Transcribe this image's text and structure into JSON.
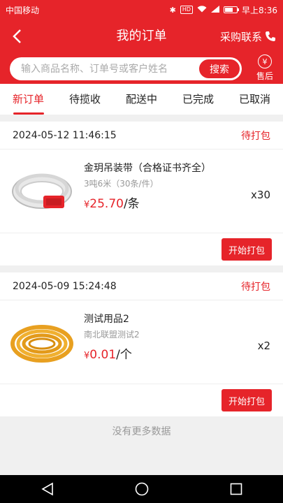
{
  "statusbar": {
    "carrier": "中国移动",
    "hd": "HD",
    "signal": "4G",
    "time": "早上8:36"
  },
  "navbar": {
    "title": "我的订单",
    "contact_label": "采购联系"
  },
  "search": {
    "placeholder": "输入商品名称、订单号或客户姓名",
    "button_label": "搜索",
    "aftersale_label": "售后",
    "aftersale_icon": "¥"
  },
  "tabs": [
    {
      "label": "新订单",
      "active": true
    },
    {
      "label": "待揽收",
      "active": false
    },
    {
      "label": "配送中",
      "active": false
    },
    {
      "label": "已完成",
      "active": false
    },
    {
      "label": "已取消",
      "active": false
    }
  ],
  "orders": [
    {
      "time": "2024-05-12 11:46:15",
      "status": "待打包",
      "product": "金玥吊装带（合格证书齐全）",
      "spec": "3吨6米（30条/件）",
      "currency": "¥",
      "price": "25.70",
      "unit": "/条",
      "qty": "x30",
      "action": "开始打包",
      "image": "sling-belt-image"
    },
    {
      "time": "2024-05-09 15:24:48",
      "status": "待打包",
      "product": "测试用品2",
      "spec": "南北联盟测试2",
      "currency": "¥",
      "price": "0.01",
      "unit": "/个",
      "qty": "x2",
      "action": "开始打包",
      "image": "rope-coil-image"
    }
  ],
  "footer": {
    "no_more": "没有更多数据"
  },
  "colors": {
    "primary": "#e6242a",
    "background": "#f0f0f0"
  }
}
